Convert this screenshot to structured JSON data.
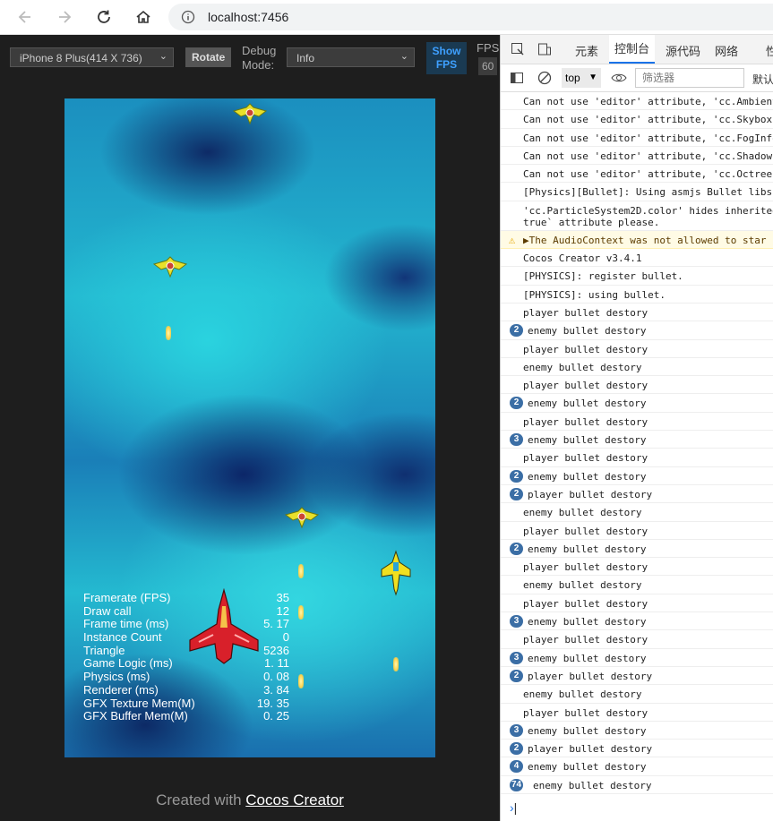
{
  "browser": {
    "url": "localhost:7456"
  },
  "toolbar": {
    "device": "iPhone 8 Plus(414 X 736)",
    "rotate": "Rotate",
    "debug_label_1": "Debug",
    "debug_label_2": "Mode:",
    "debug_mode": "Info",
    "show_fps_1": "Show",
    "show_fps_2": "FPS",
    "fps_label": "FPS:",
    "fps_value": "60"
  },
  "stats": [
    {
      "label": "Framerate (FPS)",
      "value": "35"
    },
    {
      "label": "Draw call",
      "value": "12"
    },
    {
      "label": "Frame time (ms)",
      "value": "5. 17"
    },
    {
      "label": "Instance Count",
      "value": "0"
    },
    {
      "label": "Triangle",
      "value": "5236"
    },
    {
      "label": "Game Logic (ms)",
      "value": "1. 11"
    },
    {
      "label": "Physics (ms)",
      "value": "0. 08"
    },
    {
      "label": "Renderer (ms)",
      "value": "3. 84"
    },
    {
      "label": "GFX Texture Mem(M)",
      "value": "19. 35"
    },
    {
      "label": "GFX Buffer Mem(M)",
      "value": "0. 25"
    }
  ],
  "credit": {
    "prefix": "Created with ",
    "link": "Cocos Creator"
  },
  "devtools": {
    "tabs": [
      "元素",
      "控制台",
      "源代码",
      "网络",
      "性"
    ],
    "context": "top",
    "filter_placeholder": "筛选器",
    "levels": "默认",
    "logs": [
      {
        "text": "Can not use 'editor' attribute, 'cc.Ambient",
        "count": ""
      },
      {
        "text": "Can not use 'editor' attribute, 'cc.Skybox",
        "count": ""
      },
      {
        "text": "Can not use 'editor' attribute, 'cc.FogInfo",
        "count": ""
      },
      {
        "text": "Can not use 'editor' attribute, 'cc.Shadows",
        "count": ""
      },
      {
        "text": "Can not use 'editor' attribute, 'cc.Octree",
        "count": ""
      },
      {
        "text": "[Physics][Bullet]: Using asmjs Bullet libs.",
        "count": ""
      },
      {
        "text": "'cc.ParticleSystem2D.color' hides inherited",
        "text2": "true` attribute please.",
        "count": ""
      },
      {
        "text": "▶The AudioContext was not allowed to star",
        "count": "",
        "warn": true
      },
      {
        "text": "Cocos Creator v3.4.1",
        "count": ""
      },
      {
        "text": "[PHYSICS]: register bullet.",
        "count": ""
      },
      {
        "text": "[PHYSICS]: using bullet.",
        "count": ""
      },
      {
        "text": "player bullet destory",
        "count": ""
      },
      {
        "text": "enemy bullet destory",
        "count": "2"
      },
      {
        "text": "player bullet destory",
        "count": ""
      },
      {
        "text": "enemy bullet destory",
        "count": ""
      },
      {
        "text": "player bullet destory",
        "count": ""
      },
      {
        "text": "enemy bullet destory",
        "count": "2"
      },
      {
        "text": "player bullet destory",
        "count": ""
      },
      {
        "text": "enemy bullet destory",
        "count": "3"
      },
      {
        "text": "player bullet destory",
        "count": ""
      },
      {
        "text": "enemy bullet destory",
        "count": "2"
      },
      {
        "text": "player bullet destory",
        "count": "2"
      },
      {
        "text": "enemy bullet destory",
        "count": ""
      },
      {
        "text": "player bullet destory",
        "count": ""
      },
      {
        "text": "enemy bullet destory",
        "count": "2"
      },
      {
        "text": "player bullet destory",
        "count": ""
      },
      {
        "text": "enemy bullet destory",
        "count": ""
      },
      {
        "text": "player bullet destory",
        "count": ""
      },
      {
        "text": "enemy bullet destory",
        "count": "3"
      },
      {
        "text": "player bullet destory",
        "count": ""
      },
      {
        "text": "enemy bullet destory",
        "count": "3"
      },
      {
        "text": "player bullet destory",
        "count": "2"
      },
      {
        "text": "enemy bullet destory",
        "count": ""
      },
      {
        "text": "player bullet destory",
        "count": ""
      },
      {
        "text": "enemy bullet destory",
        "count": "3"
      },
      {
        "text": "player bullet destory",
        "count": "2"
      },
      {
        "text": "enemy bullet destory",
        "count": "4"
      },
      {
        "text": "enemy bullet destory",
        "count": "74"
      }
    ]
  }
}
